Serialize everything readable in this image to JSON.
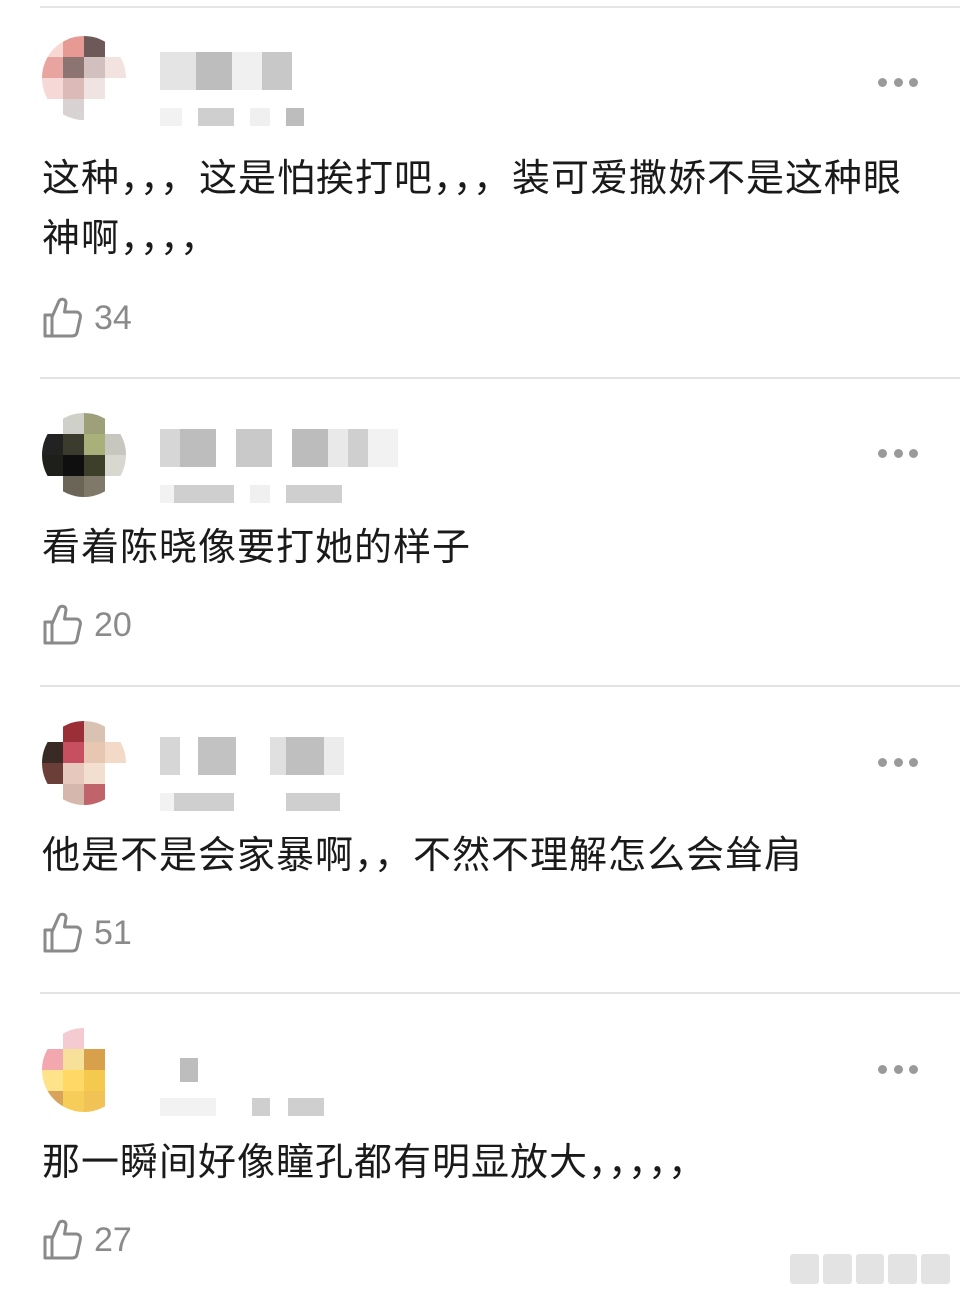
{
  "comments": [
    {
      "text": "这种，，，这是怕挨打吧，，，装可爱撒娇不是这种眼神啊，，，，",
      "likes": "34",
      "avatar_colors": [
        "#f8d7d3",
        "#e79a93",
        "#6d5a58",
        "#ffffff",
        "#e8a49f",
        "#8c7472",
        "#d2c0bf",
        "#f2e3e1",
        "#f6d9d6",
        "#dcbab8",
        "#f0e4e2",
        "#ffffff",
        "#ffffff",
        "#d8d2d2",
        "#ffffff",
        "#ffffff"
      ]
    },
    {
      "text": "看着陈晓像要打她的样子",
      "likes": "20",
      "avatar_colors": [
        "#ffffff",
        "#cfd0c8",
        "#9ea07a",
        "#ffffff",
        "#222222",
        "#3b3b2e",
        "#a9b07a",
        "#c7c7c0",
        "#1e1f1a",
        "#0f0f0f",
        "#3d3f2b",
        "#d8d8d0",
        "#ffffff",
        "#6b6558",
        "#807868",
        "#ffffff"
      ]
    },
    {
      "text": "他是不是会家暴啊，，不然不理解怎么会耸肩",
      "likes": "51",
      "avatar_colors": [
        "#ffffff",
        "#9b2f37",
        "#d9c2b2",
        "#ffffff",
        "#3a2a26",
        "#c75060",
        "#e7c6b2",
        "#f3d9c8",
        "#6b3f38",
        "#e6c8bd",
        "#f2dfd0",
        "#ffffff",
        "#ffffff",
        "#d6b7ad",
        "#c0636a",
        "#ffffff"
      ]
    },
    {
      "text": "那一瞬间好像瞳孔都有明显放大，，，，，",
      "likes": "27",
      "avatar_colors": [
        "#ffffff",
        "#f4cbd0",
        "#ffffff",
        "#ffffff",
        "#f2a8ae",
        "#f6e09a",
        "#d8a04a",
        "#ffffff",
        "#ffe38a",
        "#ffd866",
        "#f5c84e",
        "#ffffff",
        "#d8a45c",
        "#f7cd5a",
        "#f1c357",
        "#ffffff"
      ]
    }
  ],
  "icons": {
    "like": "thumbs-up-icon",
    "more": "more-dots-icon"
  },
  "colors": {
    "text": "#1a1a1a",
    "secondary": "#8a8a8a",
    "divider": "#e3e3e3",
    "background": "#ffffff"
  }
}
